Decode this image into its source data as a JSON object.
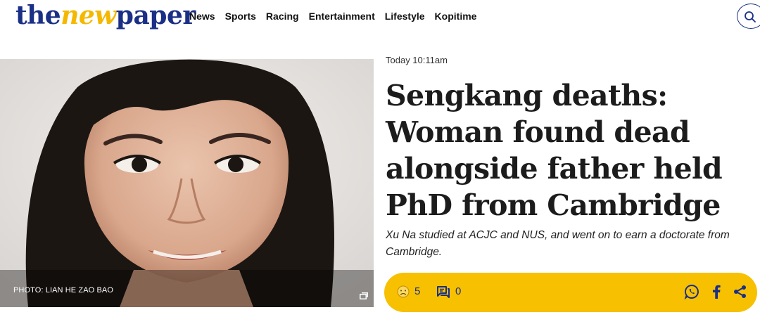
{
  "header": {
    "logo": {
      "the": "the",
      "new": "new",
      "paper": "paper"
    },
    "nav": [
      "News",
      "Sports",
      "Racing",
      "Entertainment",
      "Lifestyle",
      "Kopitime"
    ],
    "search_icon": "search-icon"
  },
  "article": {
    "photo_credit": "PHOTO: LIAN HE ZAO BAO",
    "timestamp": "Today 10:11am",
    "headline": "Sengkang deaths: Woman found dead alongside father held PhD from Cambridge",
    "standfirst": "Xu Na studied at ACJC and NUS, and went on to earn a doctorate from Cambridge.",
    "reactions_count": "5",
    "comments_count": "0",
    "share_icons": [
      "whatsapp-icon",
      "facebook-icon",
      "share-icon"
    ]
  },
  "colors": {
    "brand_blue": "#1a2f86",
    "brand_yellow": "#f5b800",
    "action_bar": "#f7c001"
  }
}
